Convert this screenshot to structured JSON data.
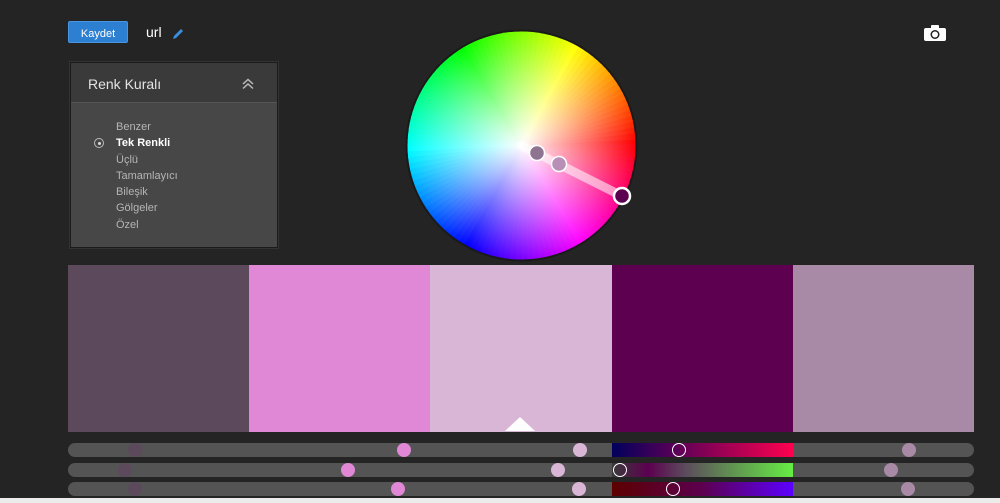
{
  "toolbar": {
    "save_label": "Kaydet",
    "title": "url"
  },
  "rule_panel": {
    "title": "Renk Kuralı",
    "items": [
      {
        "label": "Benzer",
        "selected": false
      },
      {
        "label": "Tek Renkli",
        "selected": true
      },
      {
        "label": "Üçlü",
        "selected": false
      },
      {
        "label": "Tamamlayıcı",
        "selected": false
      },
      {
        "label": "Bileşik",
        "selected": false
      },
      {
        "label": "Gölgeler",
        "selected": false
      },
      {
        "label": "Özel",
        "selected": false
      }
    ]
  },
  "icons": {
    "edit": "pencil-icon",
    "capture": "camera-icon",
    "collapse": "double-chevron-up-icon",
    "radio": "radio-icon"
  },
  "swatches": [
    {
      "color": "#5c4a5c"
    },
    {
      "color": "#e088d6"
    },
    {
      "color": "#dab6d6"
    },
    {
      "color": "#5c004f"
    },
    {
      "color": "#a98aa6"
    }
  ],
  "selected_swatch_index": 2,
  "colors": {
    "background": "#242424",
    "accent": "#2d7fd2",
    "panel": "#474747"
  }
}
